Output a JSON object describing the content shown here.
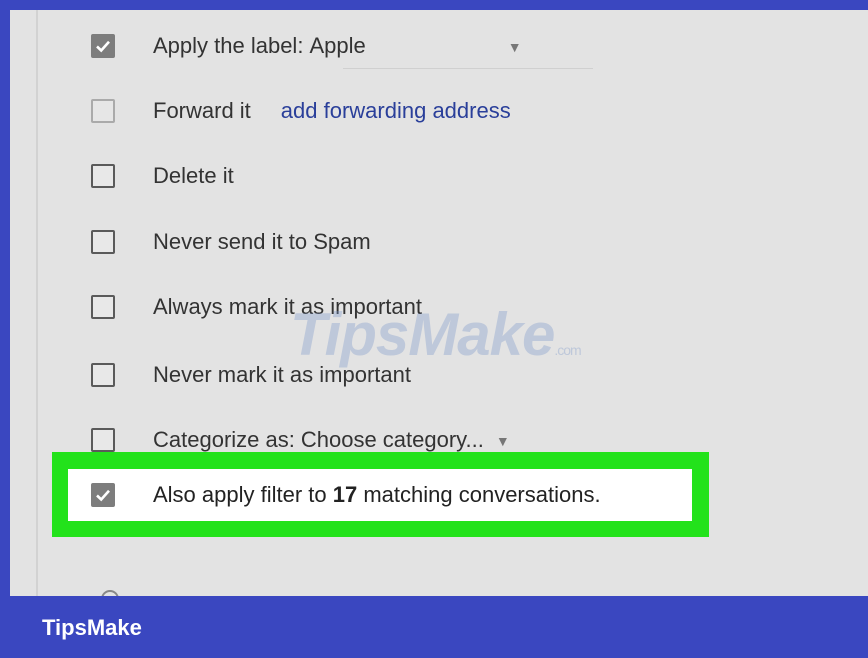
{
  "filter_actions": [
    {
      "label": "Apply the label:",
      "value": "Apple",
      "checked": true
    },
    {
      "label": "Forward it",
      "link": "add forwarding address",
      "checked": false
    },
    {
      "label": "Delete it",
      "checked": false
    },
    {
      "label": "Never send it to Spam",
      "checked": false
    },
    {
      "label": "Always mark it as important",
      "checked": false
    },
    {
      "label": "Never mark it as important",
      "checked": false
    },
    {
      "label": "Categorize as:",
      "value": "Choose category...",
      "checked": false
    }
  ],
  "apply_existing": {
    "prefix": "Also apply filter to ",
    "count": "17",
    "suffix": " matching conversations.",
    "checked": true
  },
  "watermark": {
    "text": "TipsMake",
    "suffix": ".com"
  },
  "brand": "TipsMake",
  "colors": {
    "frame": "#3a47c0",
    "highlight": "#23e21b",
    "link": "#2a3f9a"
  }
}
